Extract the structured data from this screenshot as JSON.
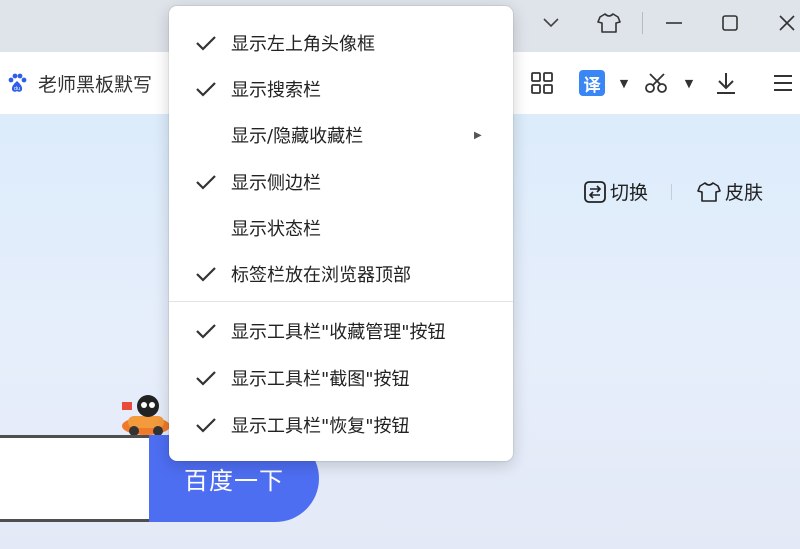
{
  "browser": {
    "tab_title": "老师黑板默写",
    "tab_icon": "baidu-paw-icon"
  },
  "page": {
    "switch_label": "切换",
    "skin_label": "皮肤",
    "search_button": "百度一下"
  },
  "menu": {
    "items": [
      {
        "label": "显示左上角头像框",
        "checked": true
      },
      {
        "label": "显示搜索栏",
        "checked": true
      },
      {
        "label": "显示/隐藏收藏栏",
        "checked": false,
        "submenu": true
      },
      {
        "label": "显示侧边栏",
        "checked": true
      },
      {
        "label": "显示状态栏",
        "checked": false
      },
      {
        "label": "标签栏放在浏览器顶部",
        "checked": true
      },
      {
        "label": "显示工具栏\"收藏管理\"按钮",
        "checked": true
      },
      {
        "label": "显示工具栏\"截图\"按钮",
        "checked": true
      },
      {
        "label": "显示工具栏\"恢复\"按钮",
        "checked": true
      }
    ]
  },
  "colors": {
    "accent_blue": "#4e6ef2",
    "translate_blue": "#3a86f5",
    "titlebar_bg": "#dfe3ea"
  }
}
